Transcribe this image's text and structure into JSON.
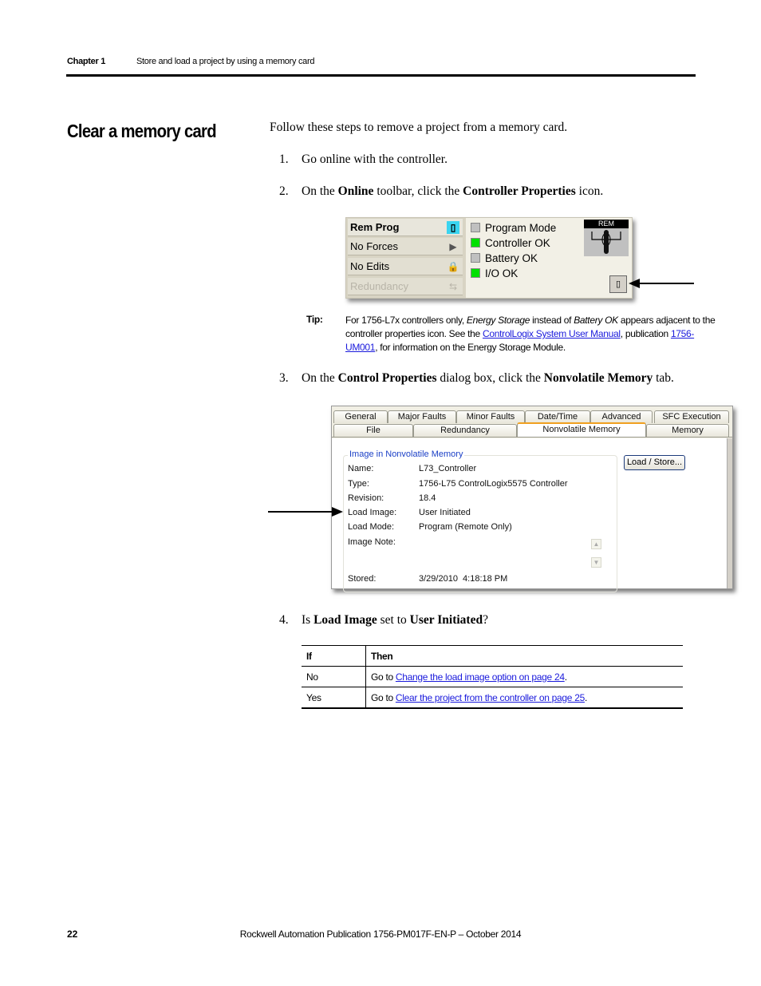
{
  "header": {
    "chapter": "Chapter 1",
    "title": "Store and load a project by using a memory card"
  },
  "section_title": "Clear a memory card",
  "intro": "Follow these steps to remove a project from a memory card.",
  "steps": [
    {
      "num": "1.",
      "parts": [
        {
          "t": "Go online with the controller.",
          "b": false
        }
      ]
    },
    {
      "num": "2.",
      "parts": [
        {
          "t": "On the ",
          "b": false
        },
        {
          "t": "Online",
          "b": true
        },
        {
          "t": " toolbar, click the ",
          "b": false
        },
        {
          "t": "Controller Properties",
          "b": true
        },
        {
          "t": " icon.",
          "b": false
        }
      ]
    },
    {
      "num": "3.",
      "parts": [
        {
          "t": "On the ",
          "b": false
        },
        {
          "t": "Control Properties",
          "b": true
        },
        {
          "t": " dialog box, click the ",
          "b": false
        },
        {
          "t": "Nonvolatile Memory",
          "b": true
        },
        {
          "t": " tab.",
          "b": false
        }
      ]
    },
    {
      "num": "4.",
      "parts": [
        {
          "t": "Is ",
          "b": false
        },
        {
          "t": "Load Image",
          "b": true
        },
        {
          "t": " set to ",
          "b": false
        },
        {
          "t": "User Initiated",
          "b": true
        },
        {
          "t": "?",
          "b": false
        }
      ]
    }
  ],
  "toolbar": {
    "rows": [
      {
        "label": "Rem Prog",
        "icon": "controller-mode-icon"
      },
      {
        "label": "No Forces",
        "icon": "forces-arrow-icon"
      },
      {
        "label": "No Edits",
        "icon": "edits-lock-icon"
      },
      {
        "label": "Redundancy",
        "icon": "redundancy-icon"
      }
    ],
    "status": [
      {
        "label": "Program Mode",
        "color": "#c0c0c0"
      },
      {
        "label": "Controller OK",
        "color": "#00e000"
      },
      {
        "label": "Battery OK",
        "color": "#c0c0c0"
      },
      {
        "label": "I/O OK",
        "color": "#00e000"
      }
    ],
    "keyswitch_label": "REM"
  },
  "tip": {
    "label": "Tip:",
    "text_1": "For 1756-L7x controllers only, ",
    "em_1": "Energy Storage",
    "text_2": " instead of ",
    "em_2": "Battery OK",
    "text_3": " appears adjacent to the controller properties icon. See the ",
    "link_1": "ControlLogix System User Manual",
    "text_4": ", publication ",
    "link_2": "1756-UM001",
    "text_5": ", for information on the Energy Storage Module."
  },
  "dialog": {
    "tabs_row1": [
      "General",
      "Major Faults",
      "Minor Faults",
      "Date/Time",
      "Advanced",
      "SFC Execution"
    ],
    "tabs_row2": [
      "File",
      "Redundancy",
      "Nonvolatile Memory",
      "Memory"
    ],
    "active_tab": "Nonvolatile Memory",
    "group_title": "Image in Nonvolatile Memory",
    "properties": [
      {
        "label": "Name:",
        "value": "L73_Controller"
      },
      {
        "label": "Type:",
        "value": "1756-L75 ControlLogix5575 Controller"
      },
      {
        "label": "Revision:",
        "value": "18.4"
      },
      {
        "label": "Load Image:",
        "value": "User Initiated"
      },
      {
        "label": "Load Mode:",
        "value": "Program (Remote Only)"
      },
      {
        "label": "Image Note:",
        "value": ""
      },
      {
        "label": "Stored:",
        "value": "3/29/2010  4:18:18 PM"
      }
    ],
    "load_store_button": "Load / Store..."
  },
  "table": {
    "headers": [
      "If",
      "Then"
    ],
    "rows": [
      {
        "if": "No",
        "prefix": "Go to ",
        "link": "Change the load image option on page 24",
        "suffix": "."
      },
      {
        "if": "Yes",
        "prefix": "Go to ",
        "link": "Clear the project from the controller on page 25",
        "suffix": "."
      }
    ]
  },
  "footer": {
    "page": "22",
    "publication": "Rockwell Automation Publication 1756-PM017F-EN-P – October 2014"
  }
}
